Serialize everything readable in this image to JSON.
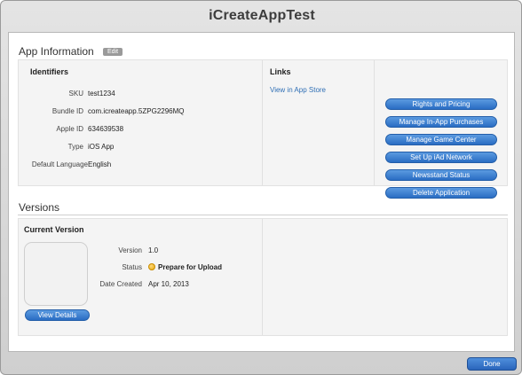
{
  "window": {
    "title": "iCreateAppTest"
  },
  "app_info": {
    "heading": "App Information",
    "edit_label": "Edit",
    "identifiers": {
      "heading": "Identifiers",
      "fields": [
        {
          "label": "SKU",
          "value": "test1234"
        },
        {
          "label": "Bundle ID",
          "value": "com.icreateapp.5ZPG2296MQ"
        },
        {
          "label": "Apple ID",
          "value": "634639538"
        },
        {
          "label": "Type",
          "value": "iOS App"
        },
        {
          "label": "Default Language",
          "value": "English"
        }
      ]
    },
    "links": {
      "heading": "Links",
      "view_in_store": "View in App Store"
    },
    "actions": [
      "Rights and Pricing",
      "Manage In-App Purchases",
      "Manage Game Center",
      "Set Up iAd Network",
      "Newsstand Status",
      "Delete Application"
    ]
  },
  "versions": {
    "heading": "Versions",
    "current": {
      "heading": "Current Version",
      "version_label": "Version",
      "version_value": "1.0",
      "status_label": "Status",
      "status_value": "Prepare for Upload",
      "status_color": "#f0b323",
      "date_label": "Date Created",
      "date_value": "Apr 10, 2013",
      "view_details": "View Details"
    }
  },
  "footer": {
    "done_label": "Done"
  },
  "colors": {
    "accent": "#2f6fb5",
    "button": "#3b7fd0"
  }
}
